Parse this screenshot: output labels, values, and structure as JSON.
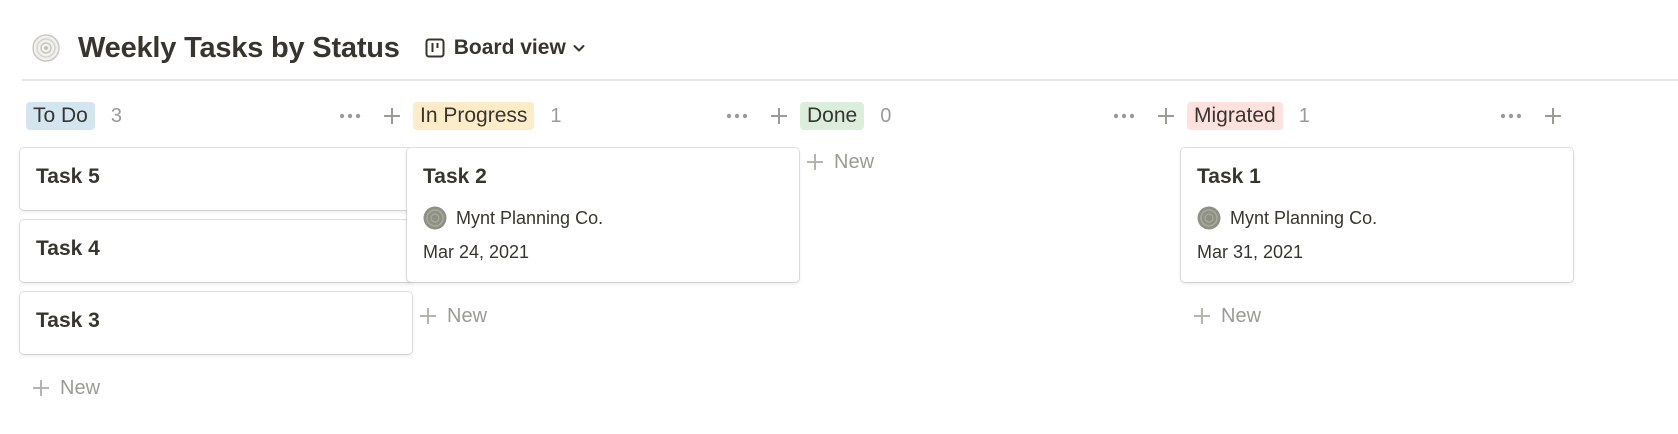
{
  "header": {
    "title": "Weekly Tasks by Status",
    "view_label": "Board view"
  },
  "columns": [
    {
      "label": "To Do",
      "count": "3",
      "pill_color": "#d3e5ef",
      "cards": [
        {
          "title": "Task 5"
        },
        {
          "title": "Task 4"
        },
        {
          "title": "Task 3"
        }
      ],
      "new_label": "New"
    },
    {
      "label": "In Progress",
      "count": "1",
      "pill_color": "#fdecc8",
      "cards": [
        {
          "title": "Task 2",
          "owner": "Mynt Planning Co.",
          "date": "Mar 24, 2021"
        }
      ],
      "new_label": "New"
    },
    {
      "label": "Done",
      "count": "0",
      "pill_color": "#dbeddb",
      "cards": [],
      "new_label": "New"
    },
    {
      "label": "Migrated",
      "count": "1",
      "pill_color": "#ffe2dd",
      "cards": [
        {
          "title": "Task 1",
          "owner": "Mynt Planning Co.",
          "date": "Mar 31, 2021"
        }
      ],
      "new_label": "New"
    }
  ],
  "icons": {
    "database": "target-icon",
    "view": "board-view-icon",
    "chevron": "chevron-down-icon",
    "more": "more-icon",
    "add": "plus-icon",
    "avatar": "avatar-icon"
  }
}
